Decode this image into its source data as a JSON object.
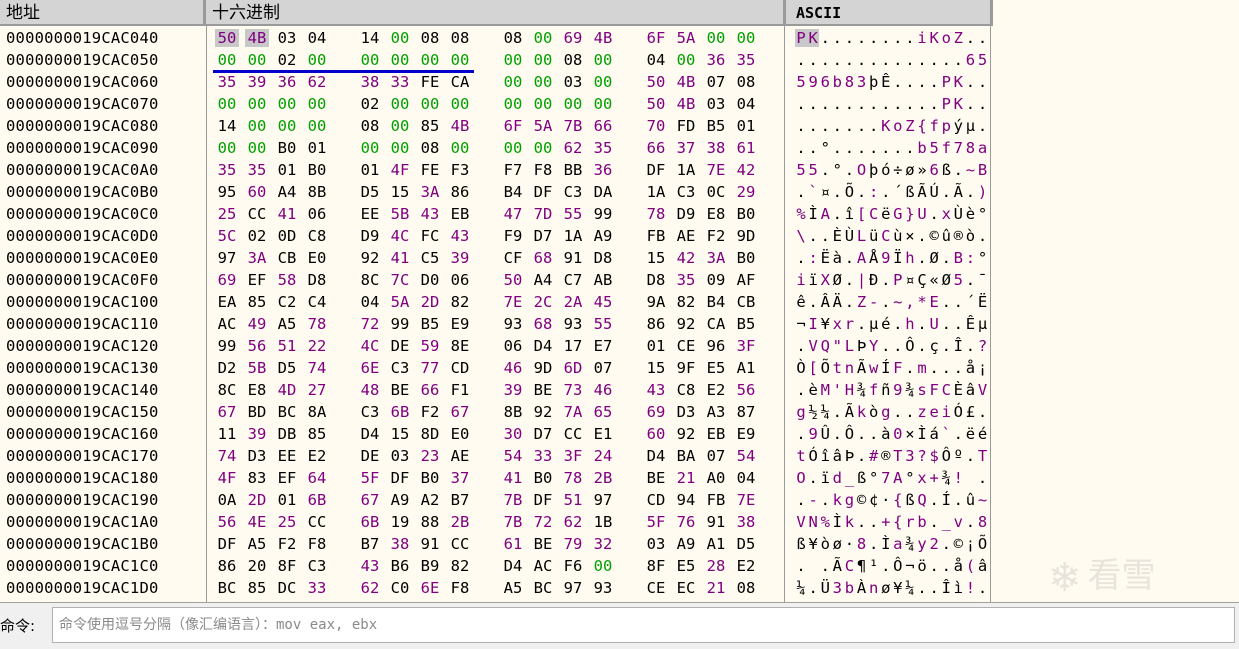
{
  "columns": {
    "address": "地址",
    "hex": "十六进制",
    "ascii": "ASCII"
  },
  "colors": {
    "zero": "#00a000",
    "default": "#000000",
    "printable": "#800080",
    "underline": "#0000cc",
    "selection": "#c8c8c8"
  },
  "rows": [
    {
      "address": "0000000019CAC040",
      "hex": [
        "50",
        "4B",
        "03",
        "04",
        "14",
        "00",
        "08",
        "08",
        "08",
        "00",
        "69",
        "4B",
        "6F",
        "5A",
        "00",
        "00"
      ],
      "ascii": "PK........iKoZ.."
    },
    {
      "address": "0000000019CAC050",
      "hex": [
        "00",
        "00",
        "02",
        "00",
        "00",
        "00",
        "00",
        "00",
        "00",
        "00",
        "08",
        "00",
        "04",
        "00",
        "36",
        "35"
      ],
      "ascii": "..............65"
    },
    {
      "address": "0000000019CAC060",
      "hex": [
        "35",
        "39",
        "36",
        "62",
        "38",
        "33",
        "FE",
        "CA",
        "00",
        "00",
        "03",
        "00",
        "50",
        "4B",
        "07",
        "08"
      ],
      "ascii": "596b83þÊ....PK.."
    },
    {
      "address": "0000000019CAC070",
      "hex": [
        "00",
        "00",
        "00",
        "00",
        "02",
        "00",
        "00",
        "00",
        "00",
        "00",
        "00",
        "00",
        "50",
        "4B",
        "03",
        "04"
      ],
      "ascii": "............PK.."
    },
    {
      "address": "0000000019CAC080",
      "hex": [
        "14",
        "00",
        "00",
        "00",
        "08",
        "00",
        "85",
        "4B",
        "6F",
        "5A",
        "7B",
        "66",
        "70",
        "FD",
        "B5",
        "01"
      ],
      "ascii": ".......KoZ{fpýµ."
    },
    {
      "address": "0000000019CAC090",
      "hex": [
        "00",
        "00",
        "B0",
        "01",
        "00",
        "00",
        "08",
        "00",
        "00",
        "00",
        "62",
        "35",
        "66",
        "37",
        "38",
        "61"
      ],
      "ascii": "..°.......b5f78a"
    },
    {
      "address": "0000000019CAC0A0",
      "hex": [
        "35",
        "35",
        "01",
        "B0",
        "01",
        "4F",
        "FE",
        "F3",
        "F7",
        "F8",
        "BB",
        "36",
        "DF",
        "1A",
        "7E",
        "42"
      ],
      "ascii": "55.°.Oþó÷ø»6ß.~B"
    },
    {
      "address": "0000000019CAC0B0",
      "hex": [
        "95",
        "60",
        "A4",
        "8B",
        "D5",
        "15",
        "3A",
        "86",
        "B4",
        "DF",
        "C3",
        "DA",
        "1A",
        "C3",
        "0C",
        "29"
      ],
      "ascii": ".`¤.Õ.:.´ßÃÚ.Ã.)"
    },
    {
      "address": "0000000019CAC0C0",
      "hex": [
        "25",
        "CC",
        "41",
        "06",
        "EE",
        "5B",
        "43",
        "EB",
        "47",
        "7D",
        "55",
        "99",
        "78",
        "D9",
        "E8",
        "B0"
      ],
      "ascii": "%ÌA.î[CëG}U.xÙè°"
    },
    {
      "address": "0000000019CAC0D0",
      "hex": [
        "5C",
        "02",
        "0D",
        "C8",
        "D9",
        "4C",
        "FC",
        "43",
        "F9",
        "D7",
        "1A",
        "A9",
        "FB",
        "AE",
        "F2",
        "9D"
      ],
      "ascii": "\\..ÈÙLüCù×.©û®ò."
    },
    {
      "address": "0000000019CAC0E0",
      "hex": [
        "97",
        "3A",
        "CB",
        "E0",
        "92",
        "41",
        "C5",
        "39",
        "CF",
        "68",
        "91",
        "D8",
        "15",
        "42",
        "3A",
        "B0"
      ],
      "ascii": ".:Ëà.AÅ9Ïh.Ø.B:°"
    },
    {
      "address": "0000000019CAC0F0",
      "hex": [
        "69",
        "EF",
        "58",
        "D8",
        "8C",
        "7C",
        "D0",
        "06",
        "50",
        "A4",
        "C7",
        "AB",
        "D8",
        "35",
        "09",
        "AF"
      ],
      "ascii": "iïXØ.|Ð.P¤Ç«Ø5.¯"
    },
    {
      "address": "0000000019CAC100",
      "hex": [
        "EA",
        "85",
        "C2",
        "C4",
        "04",
        "5A",
        "2D",
        "82",
        "7E",
        "2C",
        "2A",
        "45",
        "9A",
        "82",
        "B4",
        "CB"
      ],
      "ascii": "ê.ÂÄ.Z-.~,*E..´Ë"
    },
    {
      "address": "0000000019CAC110",
      "hex": [
        "AC",
        "49",
        "A5",
        "78",
        "72",
        "99",
        "B5",
        "E9",
        "93",
        "68",
        "93",
        "55",
        "86",
        "92",
        "CA",
        "B5"
      ],
      "ascii": "¬I¥xr.µé.h.U..Êµ"
    },
    {
      "address": "0000000019CAC120",
      "hex": [
        "99",
        "56",
        "51",
        "22",
        "4C",
        "DE",
        "59",
        "8E",
        "06",
        "D4",
        "17",
        "E7",
        "01",
        "CE",
        "96",
        "3F"
      ],
      "ascii": ".VQ\"LÞY..Ô.ç.Î.?"
    },
    {
      "address": "0000000019CAC130",
      "hex": [
        "D2",
        "5B",
        "D5",
        "74",
        "6E",
        "C3",
        "77",
        "CD",
        "46",
        "9D",
        "6D",
        "07",
        "15",
        "9F",
        "E5",
        "A1"
      ],
      "ascii": "Ò[ÕtnÃwÍF.m...å¡"
    },
    {
      "address": "0000000019CAC140",
      "hex": [
        "8C",
        "E8",
        "4D",
        "27",
        "48",
        "BE",
        "66",
        "F1",
        "39",
        "BE",
        "73",
        "46",
        "43",
        "C8",
        "E2",
        "56"
      ],
      "ascii": ".èM'H¾fñ9¾sFCÈâV"
    },
    {
      "address": "0000000019CAC150",
      "hex": [
        "67",
        "BD",
        "BC",
        "8A",
        "C3",
        "6B",
        "F2",
        "67",
        "8B",
        "92",
        "7A",
        "65",
        "69",
        "D3",
        "A3",
        "87"
      ],
      "ascii": "g½¼.Ãkòg..zeiÓ£."
    },
    {
      "address": "0000000019CAC160",
      "hex": [
        "11",
        "39",
        "DB",
        "85",
        "D4",
        "15",
        "8D",
        "E0",
        "30",
        "D7",
        "CC",
        "E1",
        "60",
        "92",
        "EB",
        "E9"
      ],
      "ascii": ".9Û.Ô..à0×Ìá`.ëé"
    },
    {
      "address": "0000000019CAC170",
      "hex": [
        "74",
        "D3",
        "EE",
        "E2",
        "DE",
        "03",
        "23",
        "AE",
        "54",
        "33",
        "3F",
        "24",
        "D4",
        "BA",
        "07",
        "54"
      ],
      "ascii": "tÓîâÞ.#®T3?$Ôº.T"
    },
    {
      "address": "0000000019CAC180",
      "hex": [
        "4F",
        "83",
        "EF",
        "64",
        "5F",
        "DF",
        "B0",
        "37",
        "41",
        "B0",
        "78",
        "2B",
        "BE",
        "21",
        "A0",
        "04"
      ],
      "ascii": "O.ïd_ß°7A°x+¾! ."
    },
    {
      "address": "0000000019CAC190",
      "hex": [
        "0A",
        "2D",
        "01",
        "6B",
        "67",
        "A9",
        "A2",
        "B7",
        "7B",
        "DF",
        "51",
        "97",
        "CD",
        "94",
        "FB",
        "7E"
      ],
      "ascii": ".-.kg©¢·{ßQ.Í.û~"
    },
    {
      "address": "0000000019CAC1A0",
      "hex": [
        "56",
        "4E",
        "25",
        "CC",
        "6B",
        "19",
        "88",
        "2B",
        "7B",
        "72",
        "62",
        "1B",
        "5F",
        "76",
        "91",
        "38"
      ],
      "ascii": "VN%Ìk..+{rb._v.8"
    },
    {
      "address": "0000000019CAC1B0",
      "hex": [
        "DF",
        "A5",
        "F2",
        "F8",
        "B7",
        "38",
        "91",
        "CC",
        "61",
        "BE",
        "79",
        "32",
        "03",
        "A9",
        "A1",
        "D5"
      ],
      "ascii": "ß¥òø·8.Ìa¾y2.©¡Õ"
    },
    {
      "address": "0000000019CAC1C0",
      "hex": [
        "86",
        "20",
        "8F",
        "C3",
        "43",
        "B6",
        "B9",
        "82",
        "D4",
        "AC",
        "F6",
        "00",
        "8F",
        "E5",
        "28",
        "E2"
      ],
      "ascii": ". .ÃC¶¹.Ô¬ö..å(â"
    },
    {
      "address": "0000000019CAC1D0",
      "hex": [
        "BC",
        "85",
        "DC",
        "33",
        "62",
        "C0",
        "6E",
        "F8",
        "A5",
        "BC",
        "97",
        "93",
        "CE",
        "EC",
        "21",
        "08"
      ],
      "ascii": "¼.Ü3bÀnø¥¼..Îì!."
    }
  ],
  "watermark": {
    "icon": "snowflake-icon",
    "text": "看雪"
  },
  "command": {
    "label": "命令:",
    "placeholder": "命令使用逗号分隔（像汇编语言）：mov eax, ebx",
    "value": ""
  }
}
